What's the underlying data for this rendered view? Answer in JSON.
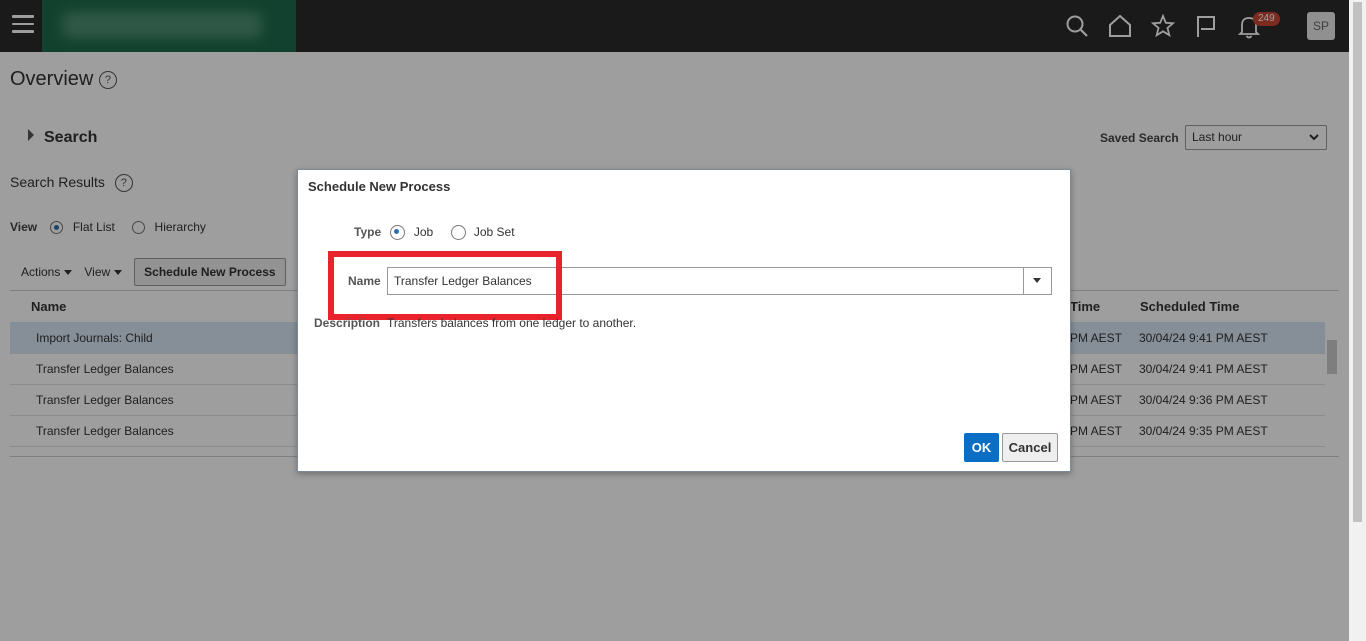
{
  "header": {
    "notifications_count": "249",
    "user_initials": "SP",
    "icons": [
      "search-icon",
      "home-icon",
      "star-icon",
      "flag-icon",
      "bell-icon"
    ]
  },
  "page": {
    "title": "Overview",
    "search_label": "Search",
    "saved_search_label": "Saved Search",
    "saved_search_value": "Last hour",
    "results_label": "Search Results",
    "view_label": "View",
    "view_options": [
      "Flat List",
      "Hierarchy"
    ],
    "toolbar": {
      "actions": "Actions",
      "view": "View",
      "schedule_btn": "Schedule New Process"
    }
  },
  "table": {
    "columns": {
      "name": "Name",
      "time": "Time",
      "scheduled": "Scheduled Time"
    },
    "rows": [
      {
        "name": "Import Journals: Child",
        "time": "PM AEST",
        "scheduled": "30/04/24 9:41 PM AEST"
      },
      {
        "name": "Transfer Ledger Balances",
        "time": "PM AEST",
        "scheduled": "30/04/24 9:41 PM AEST"
      },
      {
        "name": "Transfer Ledger Balances",
        "time": "PM AEST",
        "scheduled": "30/04/24 9:36 PM AEST"
      },
      {
        "name": "Transfer Ledger Balances",
        "time": "PM AEST",
        "scheduled": "30/04/24 9:35 PM AEST"
      }
    ]
  },
  "dialog": {
    "title": "Schedule New Process",
    "type_label": "Type",
    "type_options": [
      "Job",
      "Job Set"
    ],
    "name_label": "Name",
    "name_value": "Transfer Ledger Balances",
    "description_label": "Description",
    "description_value": "Transfers balances from one ledger to another.",
    "ok": "OK",
    "cancel": "Cancel"
  },
  "colors": {
    "highlight": "#e8232b",
    "primary": "#0a6fc4",
    "topbar": "#2b2b2b"
  }
}
